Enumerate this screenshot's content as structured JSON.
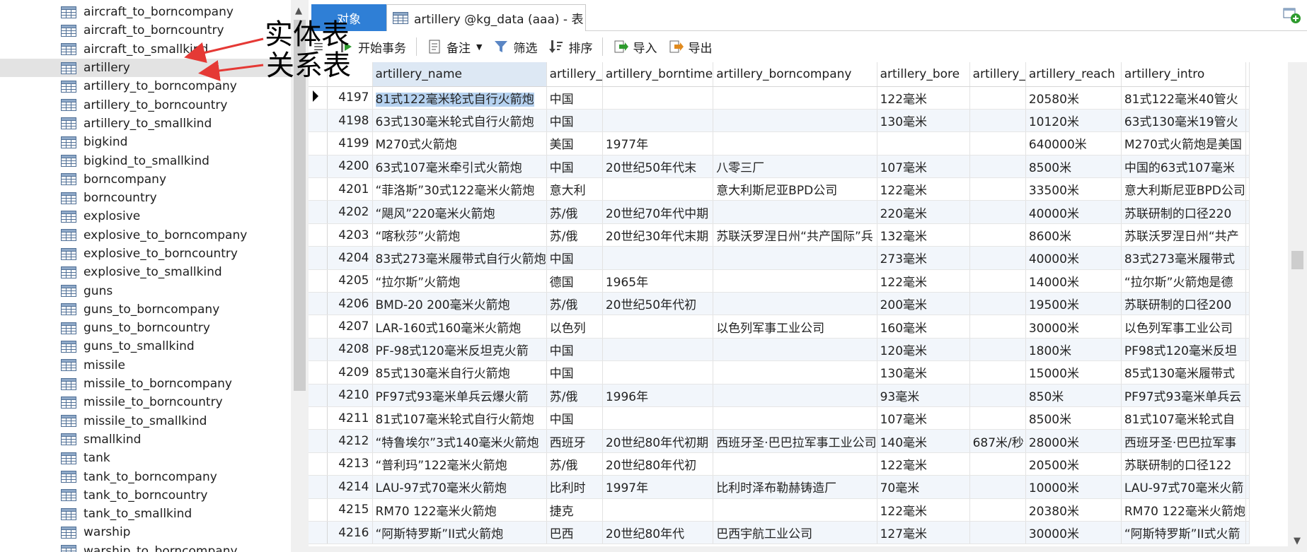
{
  "nav": {
    "items": [
      {
        "label": "aircraft_to_borncompany"
      },
      {
        "label": "aircraft_to_borncountry"
      },
      {
        "label": "aircraft_to_smallkind"
      },
      {
        "label": "artillery",
        "selected": true
      },
      {
        "label": "artillery_to_borncompany"
      },
      {
        "label": "artillery_to_borncountry"
      },
      {
        "label": "artillery_to_smallkind"
      },
      {
        "label": "bigkind"
      },
      {
        "label": "bigkind_to_smallkind"
      },
      {
        "label": "borncompany"
      },
      {
        "label": "borncountry"
      },
      {
        "label": "explosive"
      },
      {
        "label": "explosive_to_borncompany"
      },
      {
        "label": "explosive_to_borncountry"
      },
      {
        "label": "explosive_to_smallkind"
      },
      {
        "label": "guns"
      },
      {
        "label": "guns_to_borncompany"
      },
      {
        "label": "guns_to_borncountry"
      },
      {
        "label": "guns_to_smallkind"
      },
      {
        "label": "missile"
      },
      {
        "label": "missile_to_borncompany"
      },
      {
        "label": "missile_to_borncountry"
      },
      {
        "label": "missile_to_smallkind"
      },
      {
        "label": "smallkind"
      },
      {
        "label": "tank"
      },
      {
        "label": "tank_to_borncompany"
      },
      {
        "label": "tank_to_borncountry"
      },
      {
        "label": "tank_to_smallkind"
      },
      {
        "label": "warship"
      },
      {
        "label": "warship_to_borncompany"
      }
    ]
  },
  "annotations": {
    "entity_table": "实体表",
    "relation_table": "关系表",
    "arrow_color": "#e53935"
  },
  "tabs": {
    "objects": "对象",
    "table_tab": "artillery @kg_data (aaa) - 表"
  },
  "toolbar": {
    "begin_transaction": "开始事务",
    "memo": "备注",
    "filter": "筛选",
    "sort": "排序",
    "import": "导入",
    "export": "导出"
  },
  "grid": {
    "columns": [
      "artillery_name",
      "artillery_",
      "artillery_borntime",
      "artillery_borncompany",
      "artillery_bore",
      "artillery_",
      "artillery_reach",
      "artillery_intro"
    ],
    "rows": [
      {
        "id": "4197",
        "cells": [
          "81式122毫米轮式自行火箭炮",
          "中国",
          "",
          "",
          "122毫米",
          "",
          "20580米",
          "81式122毫米40管火"
        ]
      },
      {
        "id": "4198",
        "cells": [
          "63式130毫米轮式自行火箭炮",
          "中国",
          "",
          "",
          "130毫米",
          "",
          "10120米",
          "63式130毫米19管火"
        ]
      },
      {
        "id": "4199",
        "cells": [
          "M270式火箭炮",
          "美国",
          "1977年",
          "",
          "",
          "",
          "640000米",
          "M270式火箭炮是美国"
        ]
      },
      {
        "id": "4200",
        "cells": [
          "63式107毫米牵引式火箭炮",
          "中国",
          "20世纪50年代末",
          "八零三厂",
          "107毫米",
          "",
          "8500米",
          "中国的63式107毫米"
        ]
      },
      {
        "id": "4201",
        "cells": [
          "“菲洛斯”30式122毫米火箭炮",
          "意大利",
          "",
          "意大利斯尼亚BPD公司",
          "122毫米",
          "",
          "33500米",
          "意大利斯尼亚BPD公司"
        ]
      },
      {
        "id": "4202",
        "cells": [
          "“飓风”220毫米火箭炮",
          "苏/俄",
          "20世纪70年代中期",
          "",
          "220毫米",
          "",
          "40000米",
          "苏联研制的口径220"
        ]
      },
      {
        "id": "4203",
        "cells": [
          "“喀秋莎”火箭炮",
          "苏/俄",
          "20世纪30年代末期",
          "苏联沃罗涅日州“共产国际”兵",
          "132毫米",
          "",
          "8600米",
          "苏联沃罗涅日州“共产"
        ]
      },
      {
        "id": "4204",
        "cells": [
          "83式273毫米履带式自行火箭炮",
          "中国",
          "",
          "",
          "273毫米",
          "",
          "40000米",
          "83式273毫米履带式"
        ]
      },
      {
        "id": "4205",
        "cells": [
          "“拉尔斯”火箭炮",
          "德国",
          "1965年",
          "",
          "122毫米",
          "",
          "14000米",
          "“拉尔斯”火箭炮是德"
        ]
      },
      {
        "id": "4206",
        "cells": [
          "BMD-20 200毫米火箭炮",
          "苏/俄",
          "20世纪50年代初",
          "",
          "200毫米",
          "",
          "19500米",
          "苏联研制的口径200"
        ]
      },
      {
        "id": "4207",
        "cells": [
          "LAR-160式160毫米火箭炮",
          "以色列",
          "",
          "以色列军事工业公司",
          "160毫米",
          "",
          "30000米",
          "以色列军事工业公司"
        ]
      },
      {
        "id": "4208",
        "cells": [
          "PF-98式120毫米反坦克火箭",
          "中国",
          "",
          "",
          "120毫米",
          "",
          "1800米",
          "PF98式120毫米反坦"
        ]
      },
      {
        "id": "4209",
        "cells": [
          "85式130毫米自行火箭炮",
          "中国",
          "",
          "",
          "130毫米",
          "",
          "15000米",
          "85式130毫米履带式"
        ]
      },
      {
        "id": "4210",
        "cells": [
          "PF97式93毫米单兵云爆火箭",
          "苏/俄",
          "1996年",
          "",
          "93毫米",
          "",
          "850米",
          "PF97式93毫米单兵云"
        ]
      },
      {
        "id": "4211",
        "cells": [
          "81式107毫米轮式自行火箭炮",
          "中国",
          "",
          "",
          "107毫米",
          "",
          "8500米",
          "81式107毫米轮式自"
        ]
      },
      {
        "id": "4212",
        "cells": [
          "“特鲁埃尔”3式140毫米火箭炮",
          "西班牙",
          "20世纪80年代初期",
          "西班牙圣·巴巴拉军事工业公司",
          "140毫米",
          "687米/秒",
          "28000米",
          "西班牙圣·巴巴拉军事"
        ]
      },
      {
        "id": "4213",
        "cells": [
          "“普利玛”122毫米火箭炮",
          "苏/俄",
          "20世纪80年代初",
          "",
          "122毫米",
          "",
          "20500米",
          "苏联研制的口径122"
        ]
      },
      {
        "id": "4214",
        "cells": [
          "LAU-97式70毫米火箭炮",
          "比利时",
          "1997年",
          "比利时泽布勒赫铸造厂",
          "70毫米",
          "",
          "10000米",
          "LAU-97式70毫米火箭"
        ]
      },
      {
        "id": "4215",
        "cells": [
          "RM70 122毫米火箭炮",
          "捷克",
          "",
          "",
          "122毫米",
          "",
          "20380米",
          "RM70 122毫米火箭炮"
        ]
      },
      {
        "id": "4216",
        "cells": [
          "“阿斯特罗斯”II式火箭炮",
          "巴西",
          "20世纪80年代",
          "巴西宇航工业公司",
          "127毫米",
          "",
          "30000米",
          "“阿斯特罗斯”II式火箭"
        ]
      }
    ]
  },
  "colors": {
    "accent": "#2f7fd6",
    "selected_nav": "#e3e3e3",
    "alt_row": "#f2f6fb"
  }
}
